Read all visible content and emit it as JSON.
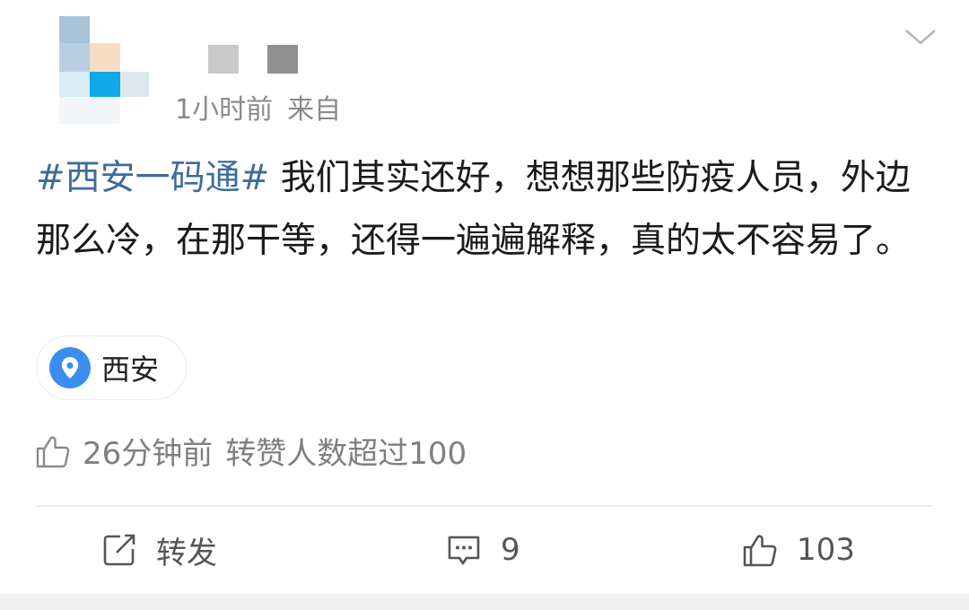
{
  "post": {
    "meta": {
      "time": "1小时前",
      "source_prefix": "来自"
    },
    "content": {
      "topic": "#西安一码通#",
      "text": " 我们其实还好，想想那些防疫人员，外边那么冷，在那干等，还得一遍遍解释，真的太不容易了。"
    },
    "location": {
      "icon": "location-pin-icon",
      "label": "西安"
    },
    "like_summary": {
      "icon": "thumbs-up-outline-icon",
      "time": "26分钟前",
      "text": "转赞人数超过100"
    },
    "actions": {
      "repost": {
        "icon": "share-box-icon",
        "label": "转发"
      },
      "comment": {
        "icon": "comment-icon",
        "count": "9"
      },
      "like": {
        "icon": "thumbs-up-icon",
        "count": "103"
      }
    },
    "colors": {
      "topic": "#3f6c9c",
      "location_pin": "#3b8ef0",
      "meta_text": "#8a8a8a",
      "body_text": "#1a1a1a"
    }
  }
}
